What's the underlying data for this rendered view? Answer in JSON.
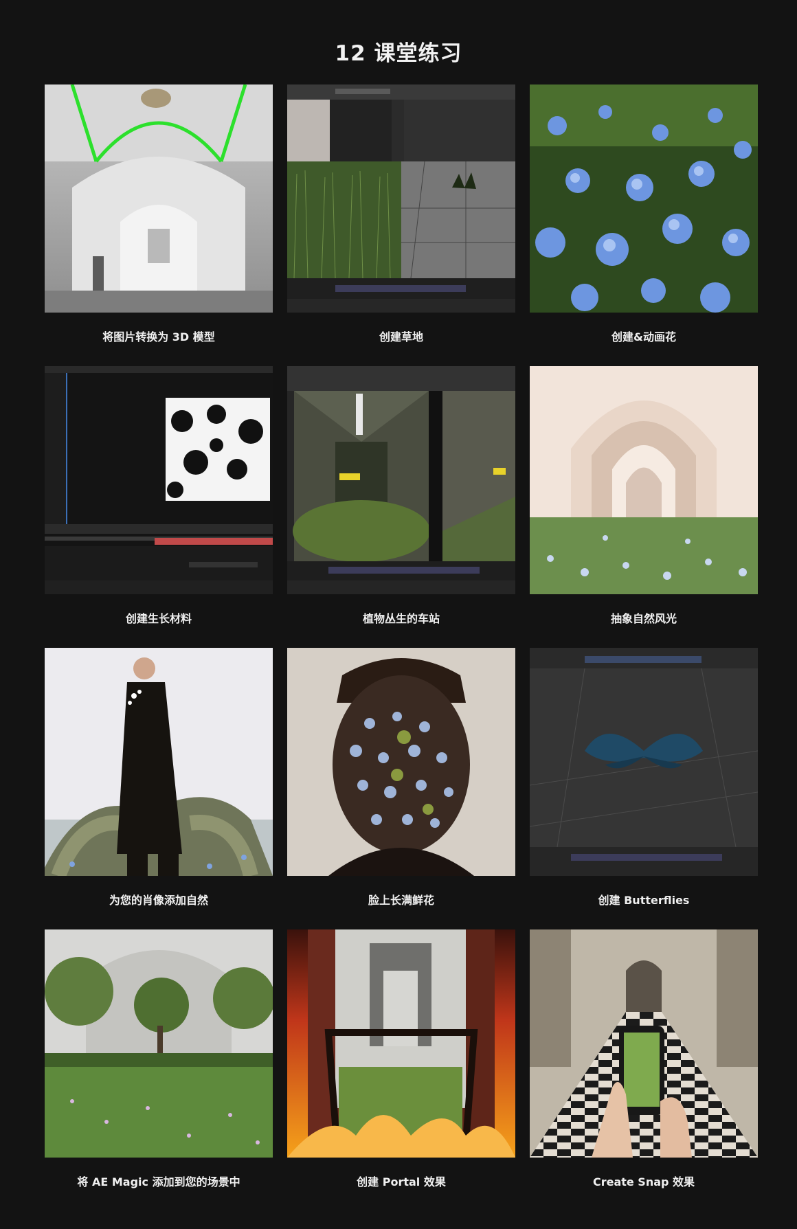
{
  "page": {
    "title": "12 课堂练习"
  },
  "lessons": [
    {
      "caption": "将图片转换为 3D 模型",
      "thumb": "cathedral-interior-image"
    },
    {
      "caption": "创建草地",
      "thumb": "grass-software-screenshot"
    },
    {
      "caption": "创建&动画花",
      "thumb": "blue-flowers-image"
    },
    {
      "caption": "创建生长材料",
      "thumb": "growth-material-screenshot"
    },
    {
      "caption": "植物丛生的车站",
      "thumb": "overgrown-station-screenshot"
    },
    {
      "caption": "抽象自然风光",
      "thumb": "arches-landscape-image"
    },
    {
      "caption": "为您的肖像添加自然",
      "thumb": "portrait-nature-image"
    },
    {
      "caption": "脸上长满鲜花",
      "thumb": "flower-face-image"
    },
    {
      "caption": "创建 Butterflies",
      "thumb": "butterfly-viewport-screenshot"
    },
    {
      "caption": "将 AE Magic 添加到您的场景中",
      "thumb": "garden-hall-image"
    },
    {
      "caption": "创建 Portal 效果",
      "thumb": "portal-bridge-image"
    },
    {
      "caption": "Create Snap 效果",
      "thumb": "phone-checker-hall-image"
    }
  ]
}
